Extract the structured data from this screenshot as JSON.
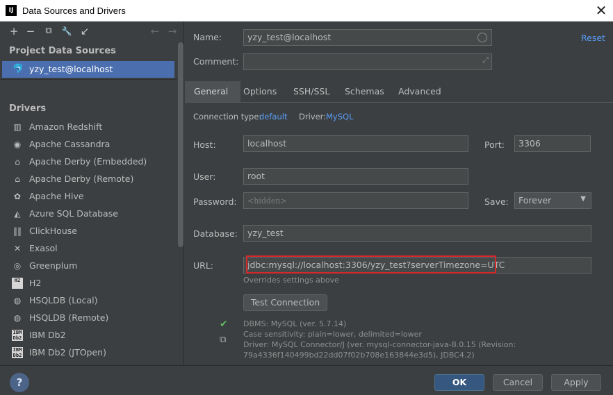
{
  "window": {
    "app_icon": "IJ",
    "title": "Data Sources and Drivers",
    "close": "✕"
  },
  "left": {
    "toolbar": [
      {
        "name": "add-icon",
        "glyph": "+"
      },
      {
        "name": "remove-icon",
        "glyph": "−"
      },
      {
        "name": "copy-icon",
        "glyph": "⧉"
      },
      {
        "name": "wrench-icon",
        "glyph": "🔧"
      },
      {
        "name": "import-icon",
        "glyph": "↙"
      },
      {
        "name": "back-arrow-icon",
        "glyph": "←"
      },
      {
        "name": "forward-arrow-icon",
        "glyph": "→"
      }
    ],
    "project_title": "Project Data Sources",
    "selected_source": "yzy_test@localhost",
    "drivers_title": "Drivers",
    "drivers": [
      {
        "label": "Amazon Redshift",
        "icon": "amazon-redshift-icon",
        "glyph": "▥"
      },
      {
        "label": "Apache Cassandra",
        "icon": "cassandra-eye-icon",
        "glyph": "◉"
      },
      {
        "label": "Apache Derby (Embedded)",
        "icon": "derby-hat-icon",
        "glyph": "⌂"
      },
      {
        "label": "Apache Derby (Remote)",
        "icon": "derby-hat-icon",
        "glyph": "⌂"
      },
      {
        "label": "Apache Hive",
        "icon": "hive-icon",
        "glyph": "✿"
      },
      {
        "label": "Azure SQL Database",
        "icon": "azure-icon",
        "glyph": "◭"
      },
      {
        "label": "ClickHouse",
        "icon": "clickhouse-bars-icon",
        "glyph": "‖‖"
      },
      {
        "label": "Exasol",
        "icon": "exasol-x-icon",
        "glyph": "✕"
      },
      {
        "label": "Greenplum",
        "icon": "greenplum-icon",
        "glyph": "◎"
      },
      {
        "label": "H2",
        "icon": "h2-icon",
        "glyph": "H2"
      },
      {
        "label": "HSQLDB (Local)",
        "icon": "hsqldb-icon",
        "glyph": "◍"
      },
      {
        "label": "HSQLDB (Remote)",
        "icon": "hsqldb-icon",
        "glyph": "◍"
      },
      {
        "label": "IBM Db2",
        "icon": "ibm-db2-icon",
        "glyph": "IBM Db2"
      },
      {
        "label": "IBM Db2 (JTOpen)",
        "icon": "ibm-db2-icon",
        "glyph": "IBM Db2"
      }
    ]
  },
  "form": {
    "name_label": "Name:",
    "name_value": "yzy_test@localhost",
    "reset": "Reset",
    "comment_label": "Comment:",
    "comment_value": "",
    "tabs": [
      "General",
      "Options",
      "SSH/SSL",
      "Schemas",
      "Advanced"
    ],
    "connection_type_label": "Connection type:",
    "connection_type_value": "default",
    "driver_label": "Driver:",
    "driver_value": "MySQL",
    "host_label": "Host:",
    "host_value": "localhost",
    "port_label": "Port:",
    "port_value": "3306",
    "user_label": "User:",
    "user_value": "root",
    "password_label": "Password:",
    "password_value": "<hidden>",
    "save_label": "Save:",
    "save_value": "Forever",
    "database_label": "Database:",
    "database_value": "yzy_test",
    "url_label": "URL:",
    "url_value": "jdbc:mysql://localhost:3306/yzy_test?serverTimezone=UTC",
    "url_hint": "Overrides settings above",
    "test_connection": "Test Connection",
    "info": [
      "DBMS: MySQL (ver. 5.7.14)",
      "Case sensitivity: plain=lower, delimited=lower",
      "Driver: MySQL Connector/J (ver. mysql-connector-java-8.0.15 (Revision:",
      "79a4336f140499bd22dd07f02b708e163844e3d5), JDBC4.2)"
    ]
  },
  "buttons": {
    "help": "?",
    "ok": "OK",
    "cancel": "Cancel",
    "apply": "Apply"
  },
  "colors": {
    "accent": "#4b6eaf",
    "link": "#589df6",
    "highlight_border": "#d6282b",
    "success": "#5fb85f"
  }
}
